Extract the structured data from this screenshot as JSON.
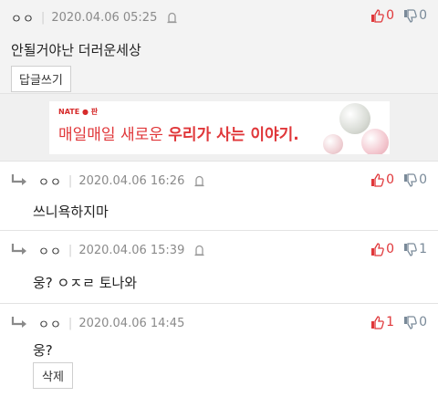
{
  "top_comment": {
    "nickname": "ㅇㅇ",
    "date": "2020.04.06 05:25",
    "text": "안될거야난 더러운세상",
    "reply_button": "답글쓰기",
    "up": "0",
    "down": "0"
  },
  "ad": {
    "brand": "NATE ● 판",
    "text_plain": "매일매일 새로운 ",
    "text_bold": "우리가 사는 이야기."
  },
  "replies": [
    {
      "nickname": "ㅇㅇ",
      "date": "2020.04.06 16:26",
      "text": "쓰니욕하지마",
      "up": "0",
      "down": "0"
    },
    {
      "nickname": "ㅇㅇ",
      "date": "2020.04.06 15:39",
      "text": "웅? ㅇㅈㄹ 토나와",
      "up": "0",
      "down": "1"
    },
    {
      "nickname": "ㅇㅇ",
      "date": "2020.04.06 14:45",
      "text": "웅?",
      "up": "1",
      "down": "0",
      "delete_button": "삭제"
    }
  ],
  "colors": {
    "up": "#e0373a",
    "down": "#7a8a99",
    "accent": "#e0373a"
  },
  "icons": [
    "reply-arrow-icon",
    "report-icon",
    "thumbs-up-icon",
    "thumbs-down-icon"
  ]
}
